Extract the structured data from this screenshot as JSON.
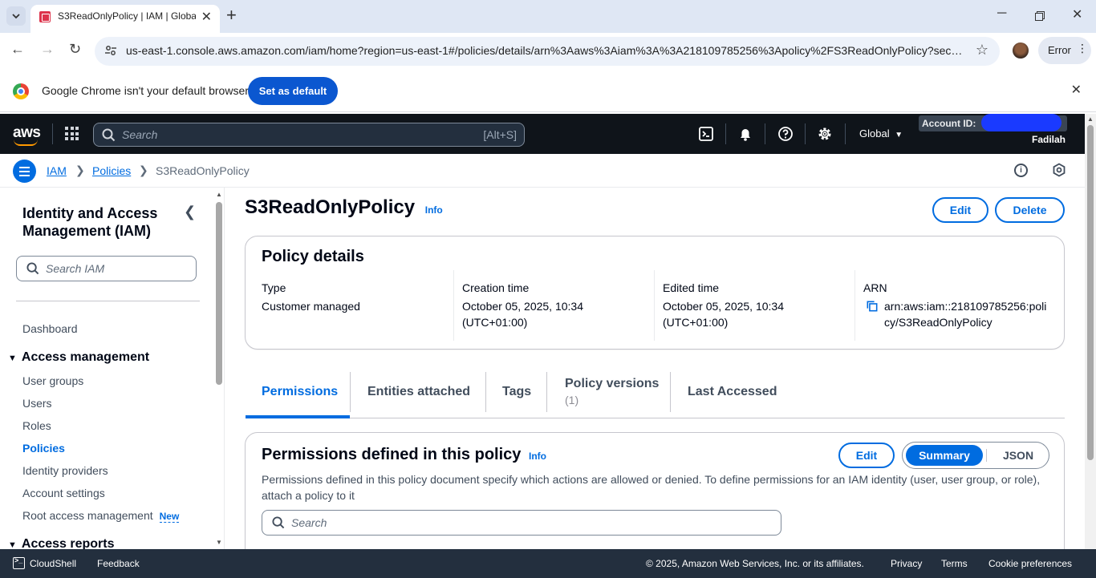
{
  "browser": {
    "tab_title": "S3ReadOnlyPolicy | IAM | Global",
    "url": "us-east-1.console.aws.amazon.com/iam/home?region=us-east-1#/policies/details/arn%3Aaws%3Aiam%3A%3A218109785256%3Apolicy%2FS3ReadOnlyPolicy?section...",
    "error_label": "Error",
    "infobar_message": "Google Chrome isn't your default browser",
    "set_default_label": "Set as default"
  },
  "aws_nav": {
    "logo": "aws",
    "search_placeholder": "Search",
    "search_shortcut": "[Alt+S]",
    "region": "Global",
    "account_label": "Account ID:",
    "username": "Fadilah"
  },
  "breadcrumb": {
    "items": [
      "IAM",
      "Policies",
      "S3ReadOnlyPolicy"
    ]
  },
  "sidebar": {
    "title": "Identity and Access Management (IAM)",
    "search_placeholder": "Search IAM",
    "dashboard": "Dashboard",
    "section_access_management": "Access management",
    "items": [
      "User groups",
      "Users",
      "Roles",
      "Policies",
      "Identity providers",
      "Account settings",
      "Root access management"
    ],
    "new_badge": "New",
    "section_access_reports": "Access reports"
  },
  "page": {
    "title": "S3ReadOnlyPolicy",
    "info": "Info",
    "edit": "Edit",
    "delete": "Delete"
  },
  "policy_details": {
    "heading": "Policy details",
    "type_label": "Type",
    "type_value": "Customer managed",
    "created_label": "Creation time",
    "created_value": "October 05, 2025, 10:34 (UTC+01:00)",
    "edited_label": "Edited time",
    "edited_value": "October 05, 2025, 10:34 (UTC+01:00)",
    "arn_label": "ARN",
    "arn_value": "arn:aws:iam::218109785256:policy/S3ReadOnlyPolicy"
  },
  "tabs": [
    {
      "label": "Permissions"
    },
    {
      "label": "Entities attached"
    },
    {
      "label": "Tags"
    },
    {
      "label": "Policy versions",
      "count": "(1)"
    },
    {
      "label": "Last Accessed"
    }
  ],
  "permissions": {
    "heading": "Permissions defined in this policy",
    "info": "Info",
    "edit": "Edit",
    "summary": "Summary",
    "json": "JSON",
    "description": "Permissions defined in this policy document specify which actions are allowed or denied. To define permissions for an IAM identity (user, user group, or role), attach a policy to it",
    "search_placeholder": "Search"
  },
  "footer": {
    "cloudshell": "CloudShell",
    "feedback": "Feedback",
    "copyright": "© 2025, Amazon Web Services, Inc. or its affiliates.",
    "privacy": "Privacy",
    "terms": "Terms",
    "cookies": "Cookie preferences"
  },
  "colors": {
    "link_blue": "#006ce0",
    "aws_nav_bg": "#0f141a",
    "aws_orange": "#ff9900",
    "footer_bg": "#232f3e"
  }
}
